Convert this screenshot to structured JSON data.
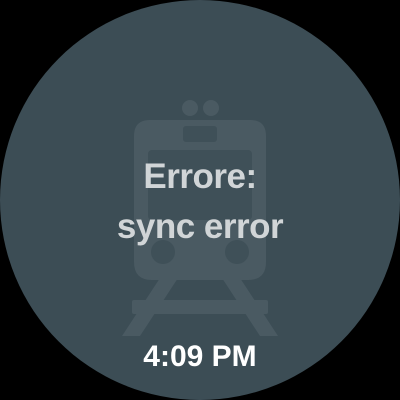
{
  "screen": {
    "background_color": "#000000",
    "face_color": "#3c4d55",
    "icon": "train-icon",
    "icon_color": "#4a5a62"
  },
  "status": {
    "line1": "Errore:",
    "line2": "sync error"
  },
  "clock": {
    "time": "4:09 PM"
  }
}
